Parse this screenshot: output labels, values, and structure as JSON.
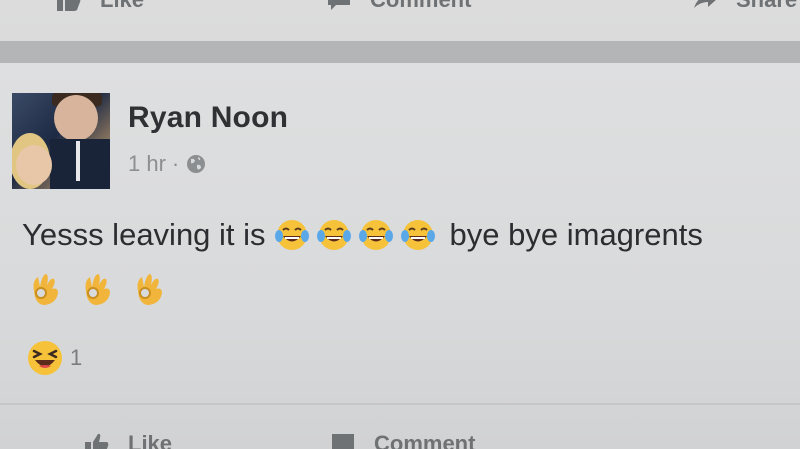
{
  "top_actions": {
    "like_label": "Like",
    "comment_label": "Comment",
    "share_label": "Share"
  },
  "post": {
    "author_name": "Ryan Noon",
    "timestamp": "1 hr",
    "separator": "·",
    "privacy_icon": "globe-icon",
    "text_before": "Yesss leaving it is",
    "laughing_emoji_count": 4,
    "text_after": "bye bye imagrents",
    "ok_emoji_count": 3,
    "reaction_icon": "haha-reaction-icon",
    "reaction_count": "1"
  },
  "bottom_actions": {
    "like_label": "Like",
    "comment_label": "Comment"
  },
  "colors": {
    "background": "#d7d8d9",
    "text": "#2b2d30",
    "muted": "#8c8f92",
    "emoji_yellow": "#f5c23a"
  }
}
